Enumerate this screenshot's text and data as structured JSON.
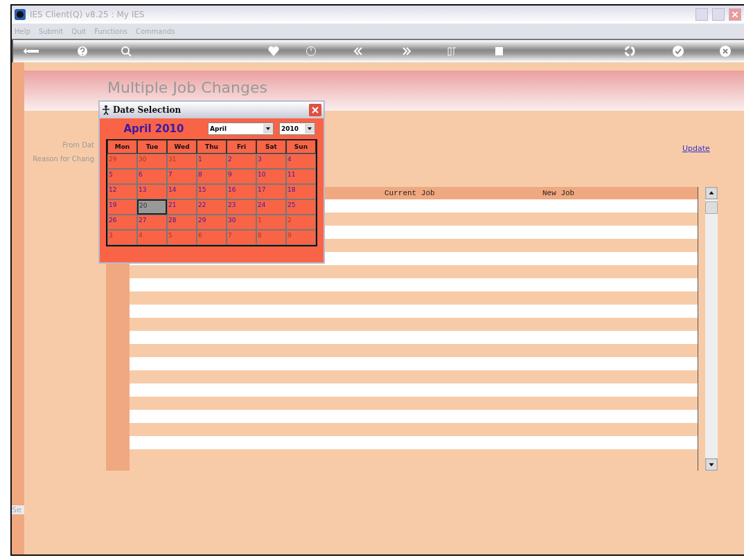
{
  "window": {
    "title": "IES Client(Q) v8.25 : My IES"
  },
  "menu": [
    "Help",
    "Submit",
    "Quit",
    "Functions",
    "Commands"
  ],
  "page_title": "Multiple Job Changes",
  "form": {
    "labels": [
      "From Dat",
      "Reason for Chang"
    ],
    "update_link": "Update"
  },
  "table": {
    "columns": [
      "Current Job",
      "New Job"
    ]
  },
  "side_tab": "Se",
  "dialog": {
    "title": "Date Selection",
    "heading": "April 2010",
    "month_select": "April",
    "year_select": "2010",
    "weekdays": [
      "Mon",
      "Tue",
      "Wed",
      "Thu",
      "Fri",
      "Sat",
      "Sun"
    ],
    "days": [
      {
        "label": "29",
        "in_month": false,
        "selected": false
      },
      {
        "label": "30",
        "in_month": false,
        "selected": false
      },
      {
        "label": "31",
        "in_month": false,
        "selected": false
      },
      {
        "label": "1",
        "in_month": true,
        "selected": false
      },
      {
        "label": "2",
        "in_month": true,
        "selected": false
      },
      {
        "label": "3",
        "in_month": true,
        "selected": false
      },
      {
        "label": "4",
        "in_month": true,
        "selected": false
      },
      {
        "label": "5",
        "in_month": true,
        "selected": false
      },
      {
        "label": "6",
        "in_month": true,
        "selected": false
      },
      {
        "label": "7",
        "in_month": true,
        "selected": false
      },
      {
        "label": "8",
        "in_month": true,
        "selected": false
      },
      {
        "label": "9",
        "in_month": true,
        "selected": false
      },
      {
        "label": "10",
        "in_month": true,
        "selected": false
      },
      {
        "label": "11",
        "in_month": true,
        "selected": false
      },
      {
        "label": "12",
        "in_month": true,
        "selected": false
      },
      {
        "label": "13",
        "in_month": true,
        "selected": false
      },
      {
        "label": "14",
        "in_month": true,
        "selected": false
      },
      {
        "label": "15",
        "in_month": true,
        "selected": false
      },
      {
        "label": "16",
        "in_month": true,
        "selected": false
      },
      {
        "label": "17",
        "in_month": true,
        "selected": false
      },
      {
        "label": "18",
        "in_month": true,
        "selected": false
      },
      {
        "label": "19",
        "in_month": true,
        "selected": false
      },
      {
        "label": "20",
        "in_month": true,
        "selected": true
      },
      {
        "label": "21",
        "in_month": true,
        "selected": false
      },
      {
        "label": "22",
        "in_month": true,
        "selected": false
      },
      {
        "label": "23",
        "in_month": true,
        "selected": false
      },
      {
        "label": "24",
        "in_month": true,
        "selected": false
      },
      {
        "label": "25",
        "in_month": true,
        "selected": false
      },
      {
        "label": "26",
        "in_month": true,
        "selected": false
      },
      {
        "label": "27",
        "in_month": true,
        "selected": false
      },
      {
        "label": "28",
        "in_month": true,
        "selected": false
      },
      {
        "label": "29",
        "in_month": true,
        "selected": false
      },
      {
        "label": "30",
        "in_month": true,
        "selected": false
      },
      {
        "label": "1",
        "in_month": false,
        "selected": false
      },
      {
        "label": "2",
        "in_month": false,
        "selected": false
      },
      {
        "label": "3",
        "in_month": false,
        "selected": false
      },
      {
        "label": "4",
        "in_month": false,
        "selected": false
      },
      {
        "label": "5",
        "in_month": false,
        "selected": false
      },
      {
        "label": "6",
        "in_month": false,
        "selected": false
      },
      {
        "label": "7",
        "in_month": false,
        "selected": false
      },
      {
        "label": "8",
        "in_month": false,
        "selected": false
      },
      {
        "label": "9",
        "in_month": false,
        "selected": false
      }
    ]
  }
}
